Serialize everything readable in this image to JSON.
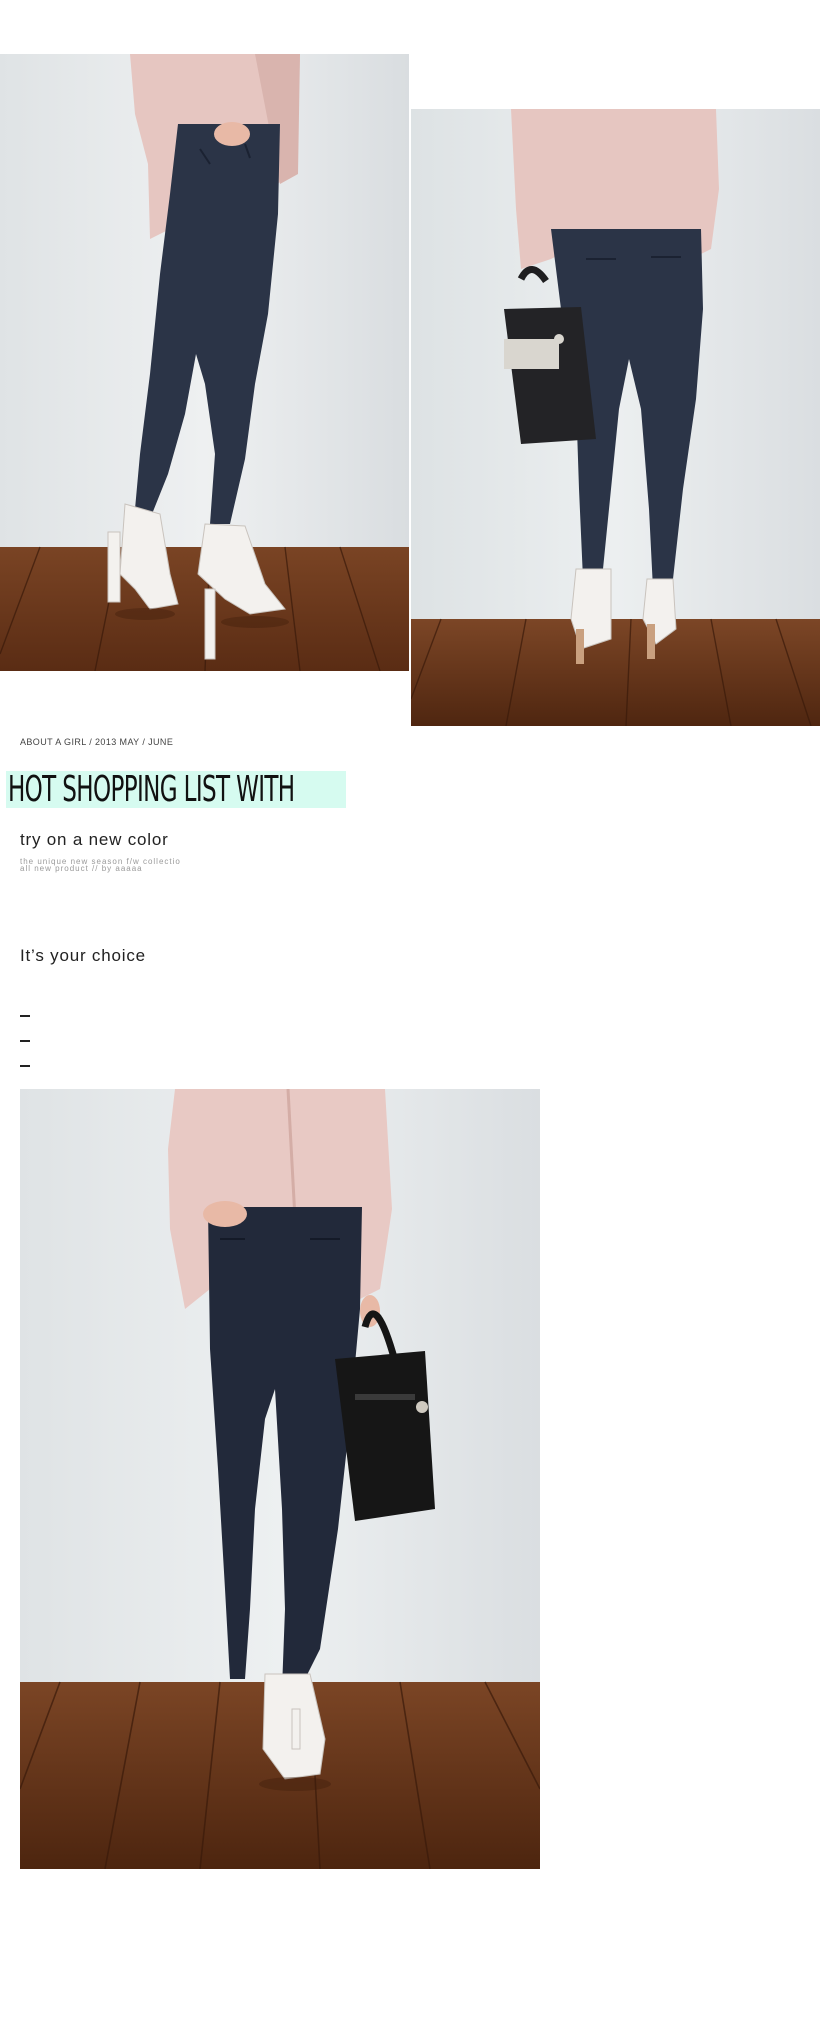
{
  "header": {
    "breadcrumb": "ABOUT A GIRL / 2013 MAY / JUNE",
    "headline": "HOT SHOPPING LIST WITH",
    "headline_highlight_color": "#d6fbf0"
  },
  "intro": {
    "subtitle": "try on a new color",
    "tagline_1": "the unique new season f/w collectio",
    "tagline_2": "all new product  //  by aaaaa"
  },
  "choice": {
    "label": "It’s your choice",
    "dashes": [
      "–",
      "–",
      "–"
    ]
  },
  "photos": [
    {
      "name": "model-front-pose",
      "colors": {
        "wall": "#e6e9ea",
        "floor": "#6e3a1c",
        "jeans": "#2b3447",
        "blouse": "#e8c9c4",
        "shoes": "#f2f0ee"
      }
    },
    {
      "name": "model-back-with-bag",
      "colors": {
        "wall": "#e6e9ea",
        "floor": "#6e3a1c",
        "jeans": "#2b3447",
        "blouse": "#e8c9c4",
        "bag": "#222225"
      }
    },
    {
      "name": "model-full-length",
      "colors": {
        "wall": "#e6e9ea",
        "floor": "#6e3a1c",
        "jeans": "#22293a",
        "blouse": "#e8c9c4",
        "bag": "#161616"
      }
    }
  ]
}
